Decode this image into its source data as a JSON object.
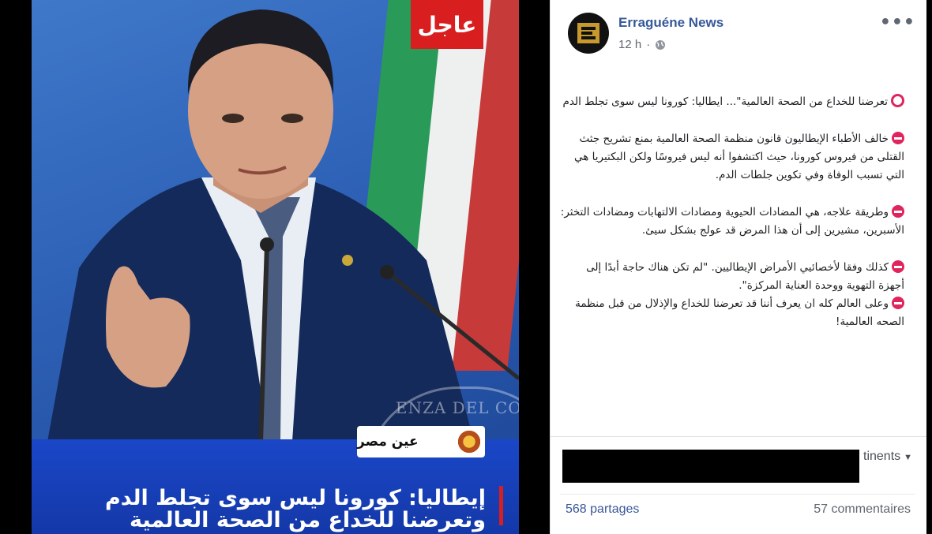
{
  "image": {
    "badge": "عاجل",
    "seal_text": "ENZA DEL CON",
    "channel_logo": "عين مصر",
    "headline": "إيطاليا: كورونا ليس سوى تجلط الدم وتعرضنا للخداع من الصحة العالمية"
  },
  "post": {
    "page_name": "Erraguéne News",
    "time": "12 h",
    "more_label": "•••",
    "paragraphs": [
      "تعرضنا للخداع من الصحة العالمية\"... ايطاليا: كورونا ليس سوى تجلط الدم",
      "خالف الأطباء الإيطاليون قانون منظمة الصحة العالمية بمنع تشريح جثث القتلى من فيروس كورونا، حيث اكتشفوا أنه ليس فيروسًا ولكن البكتيريا هي التي تسبب الوفاة وفي تكوين جلطات الدم.",
      "وطريقة علاجه، هي المضادات الحيوية ومضادات الالتهابات ومضادات التخثر: الأسبرين، مشيرين إلى أن هذا المرض قد عولج بشكل سيئ.",
      "كذلك وفقا لأخصائيي الأمراض الإيطاليين. \"لم تكن هناك حاجة أبدًا إلى أجهزة التهوية ووحدة العناية المركزة\".",
      "وعلى العالم كله ان يعرف أننا قد تعرضنا للخداع والإذلال من قبل منظمة الصحه العالمية!"
    ],
    "translate_visible": "tinents",
    "shares": "568 partages",
    "comments": "57 commentaires"
  }
}
